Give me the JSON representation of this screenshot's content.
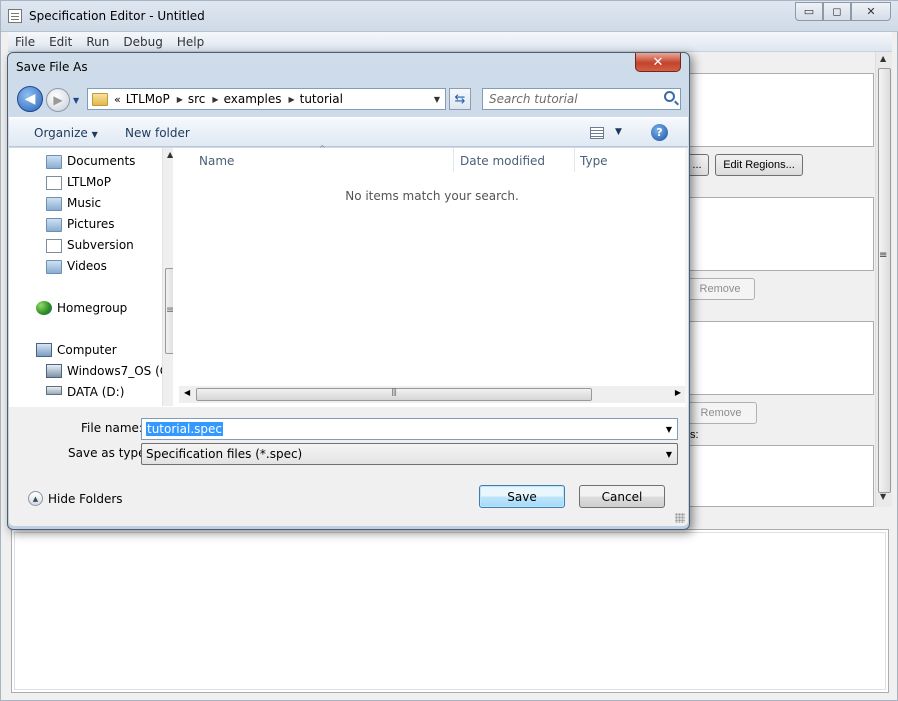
{
  "main_window": {
    "title": "Specification Editor - Untitled",
    "caption_buttons": {
      "minimize": "▭",
      "maximize": "◻",
      "close": "✕"
    },
    "menu": [
      "File",
      "Edit",
      "Run",
      "Debug",
      "Help"
    ],
    "edit_regions_button": "Edit Regions...",
    "partial_button": "...",
    "remove_button_1": "Remove",
    "remove_button_2": "Remove",
    "partial_label": "s:"
  },
  "dialog": {
    "title": "Save File As",
    "close_glyph": "✕",
    "nav": {
      "back_glyph": "◀",
      "forward_glyph": "▶",
      "history_glyph": "▼",
      "refresh_glyph": "⇆"
    },
    "breadcrumb": {
      "overflow": "«",
      "segments": [
        "LTLMoP",
        "src",
        "examples",
        "tutorial"
      ]
    },
    "search_placeholder": "Search tutorial",
    "toolbar": {
      "organize": "Organize",
      "organize_arrow": "▼",
      "new_folder": "New folder",
      "view_arrow": "▼",
      "help": "?"
    },
    "nav_pane": {
      "items": [
        {
          "label": "Documents",
          "icon": "documents-folder-icon"
        },
        {
          "label": "LTLMoP",
          "icon": "folder-icon"
        },
        {
          "label": "Music",
          "icon": "music-folder-icon"
        },
        {
          "label": "Pictures",
          "icon": "pictures-folder-icon"
        },
        {
          "label": "Subversion",
          "icon": "folder-icon"
        },
        {
          "label": "Videos",
          "icon": "videos-folder-icon"
        },
        {
          "label": "Homegroup",
          "icon": "homegroup-icon"
        },
        {
          "label": "Computer",
          "icon": "computer-icon"
        },
        {
          "label": "Windows7_OS (C",
          "icon": "os-drive-icon"
        },
        {
          "label": "DATA (D:)",
          "icon": "drive-icon"
        }
      ]
    },
    "columns": [
      "Name",
      "Date modified",
      "Type"
    ],
    "empty_message": "No items match your search.",
    "scroll": {
      "up": "▲",
      "left": "◀",
      "right": "▶",
      "grip": "|||",
      "vgrip": "≡"
    },
    "file_name_label": "File name:",
    "file_name_value": "tutorial.spec",
    "save_type_label": "Save as type:",
    "save_type_value": "Specification files (*.spec)",
    "dropdown_arrow": "▼",
    "hide_folders": "Hide Folders",
    "hide_folders_glyph": "▲",
    "save_button": "Save",
    "cancel_button": "Cancel"
  }
}
